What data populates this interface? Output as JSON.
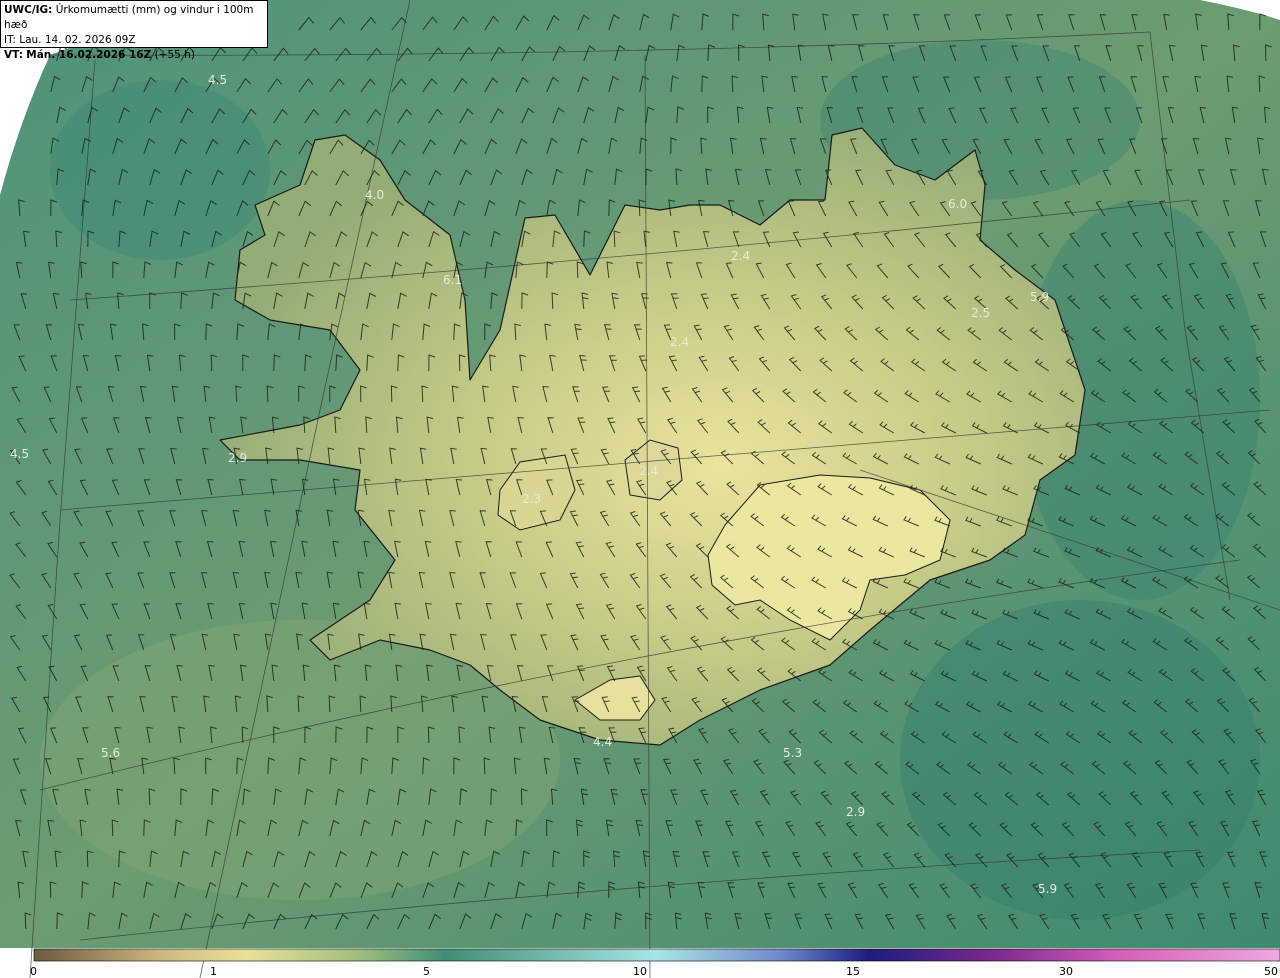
{
  "header": {
    "model": "UWC/IG:",
    "title": "Úrkomumætti (mm) og vindur i 100m hæð",
    "initial_time": "IT: Lau. 14. 02. 2026 09Z",
    "valid_time_prefix": "VT:",
    "valid_time": "Mán. 16.02.2026 16Z",
    "lead_time": "(+55 h)"
  },
  "value_labels": [
    "4.5",
    "4.0",
    "6.1",
    "4.5",
    "2.9",
    "2.3",
    "2.4",
    "2.4",
    "2.4",
    "6.0",
    "5.9",
    "2.5",
    "5.6",
    "4.4",
    "5.3",
    "2.9",
    "5.9"
  ],
  "colorbar": {
    "ticks": [
      "0",
      "1",
      "5",
      "10",
      "15",
      "30",
      "50"
    ],
    "colors": [
      "#6b5a3c",
      "#c9b880",
      "#e8e295",
      "#9fbf80",
      "#3f8f74",
      "#a9e4e4",
      "#6f88c9",
      "#1c1c7c",
      "#7a2a8c",
      "#d35fb8",
      "#f0a8e0"
    ]
  },
  "map_colors": {
    "ocean_deep": "#2f7a68",
    "ocean": "#5d9870",
    "land_low": "#9cb27a",
    "land_high": "#e2df9a",
    "coastline": "#1a1a1a",
    "grid": "#3a3a3a"
  }
}
